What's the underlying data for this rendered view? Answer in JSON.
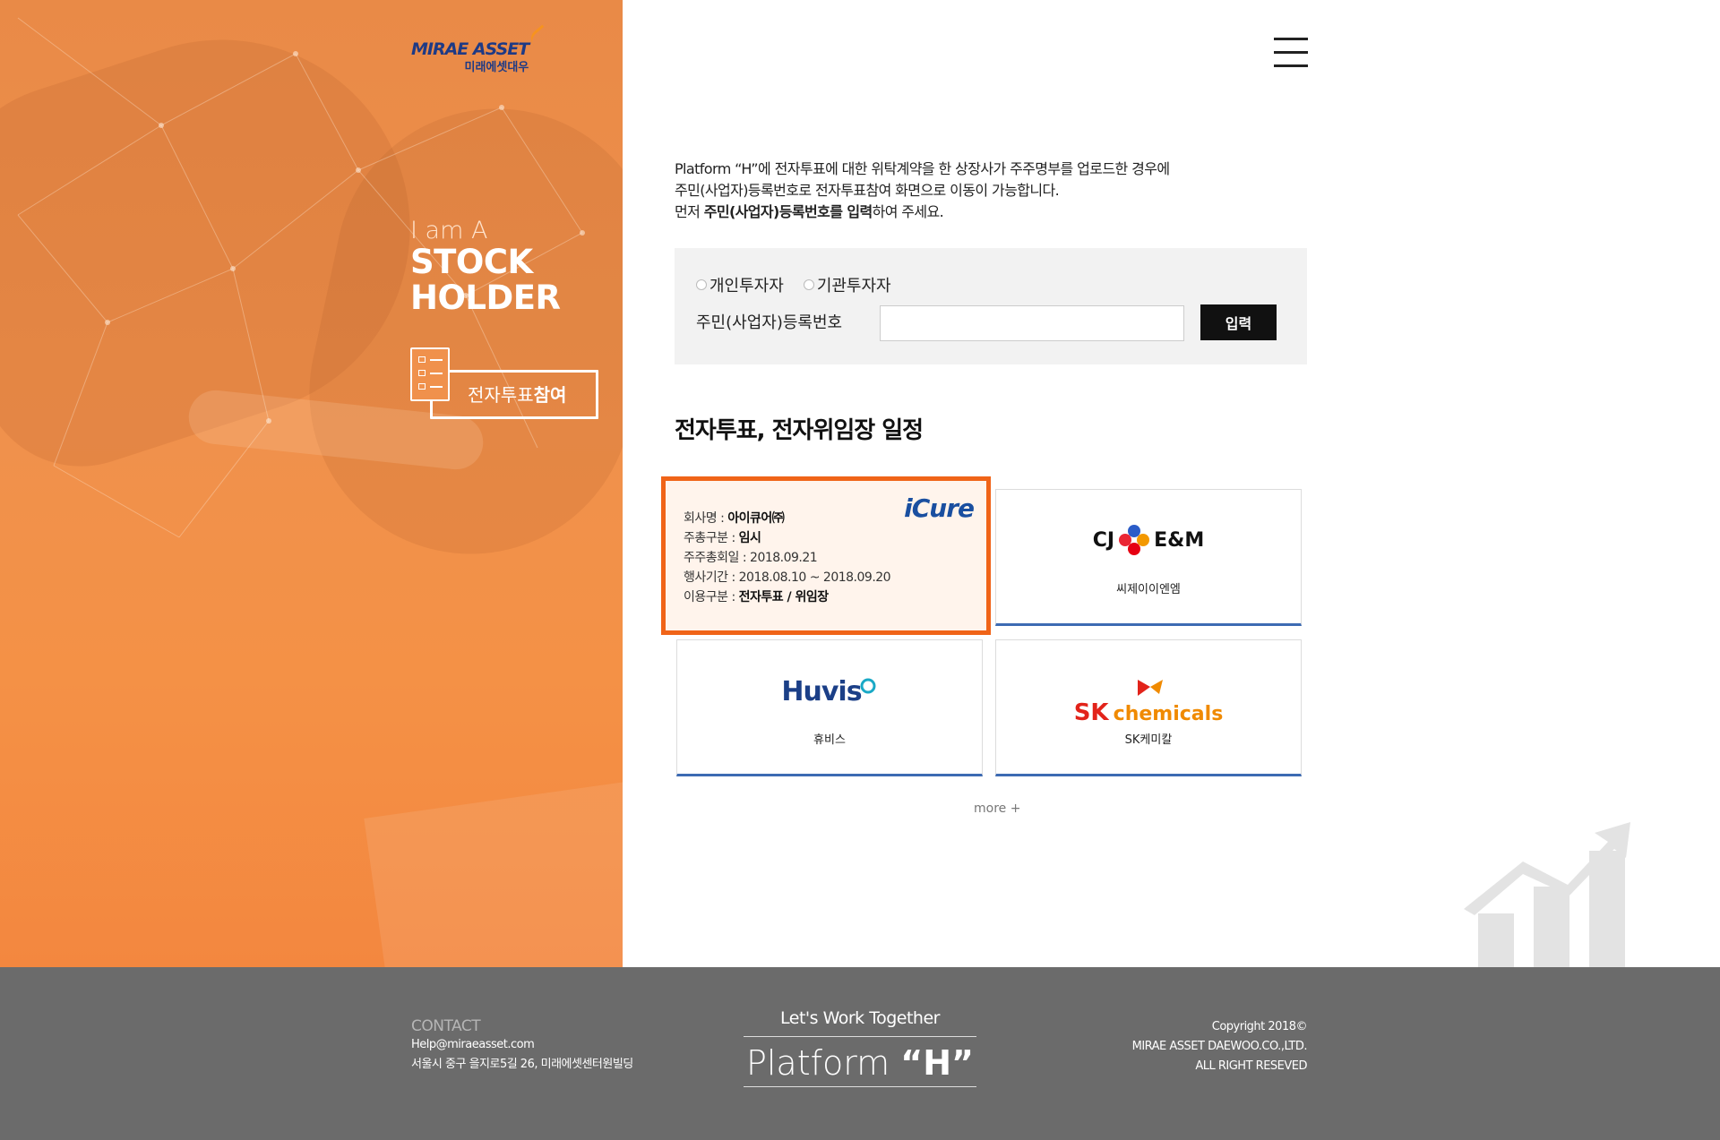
{
  "brand": {
    "logo_en": "MIRAE ASSET",
    "logo_ko": "미래에셋대우"
  },
  "hero": {
    "small_text": "I am A",
    "big_line1": "STOCK",
    "big_line2": "HOLDER",
    "vote_button_normal": "전자투표",
    "vote_button_bold": "참여"
  },
  "intro": {
    "line1": "Platform “H”에 전자투표에 대한 위탁계약을 한 상장사가 주주명부를 업로드한 경우에",
    "line2": "주민(사업자)등록번호로 전자투표참여 화면으로 이동이 가능합니다.",
    "line3_prefix": "먼저 ",
    "line3_bold": "주민(사업자)등록번호를 입력",
    "line3_suffix": "하여 주세요."
  },
  "form": {
    "radio_individual": "개인투자자",
    "radio_institution": "기관투자자",
    "id_label": "주민(사업자)등록번호",
    "id_value": "",
    "submit_label": "입력"
  },
  "schedule": {
    "title": "전자투표, 전자위임장 일정",
    "featured": {
      "logo_text": "iCure",
      "company_label": "회사명 : ",
      "company_value": "아이큐어㈜",
      "meeting_type_label": "주총구분 : ",
      "meeting_type_value": "임시",
      "meeting_date_label": "주주총회일 : ",
      "meeting_date_value": "2018.09.21",
      "period_label": "행사기간 : ",
      "period_value": "2018.08.10 ~ 2018.09.20",
      "usage_label": "이용구분 : ",
      "usage_value": "전자투표 / 위임장"
    },
    "cards": [
      {
        "logo_text": "CJ",
        "logo_text2": "E&M",
        "name": "씨제이이엔엠"
      },
      {
        "logo_text": "Huvis",
        "name": "휴비스"
      },
      {
        "logo_text": "SK",
        "logo_text2": "chemicals",
        "name": "SK케미칼"
      }
    ],
    "more_label": "more +"
  },
  "footer": {
    "contact_head": "CONTACT",
    "email": "Help@miraeasset.com",
    "address": "서울시 중구 을지로5길 26, 미래에셋센터원빌딩",
    "tagline": "Let's Work Together",
    "platform_prefix": "Platform ",
    "platform_quote": "“H”",
    "copyright": "Copyright 2018©",
    "company": "MIRAE ASSET DAEWOO.CO.,LTD.",
    "rights": "ALL RIGHT RESEVED"
  },
  "colors": {
    "hero_orange": "#f0914c",
    "active_border": "#f06418",
    "card_accent": "#3d6bb3",
    "brand_blue": "#1e3a85",
    "footer_gray": "#6b6b6b"
  },
  "icons": [
    "menu-icon",
    "document-checklist-icon",
    "radio-icon",
    "growth-chart-icon"
  ]
}
